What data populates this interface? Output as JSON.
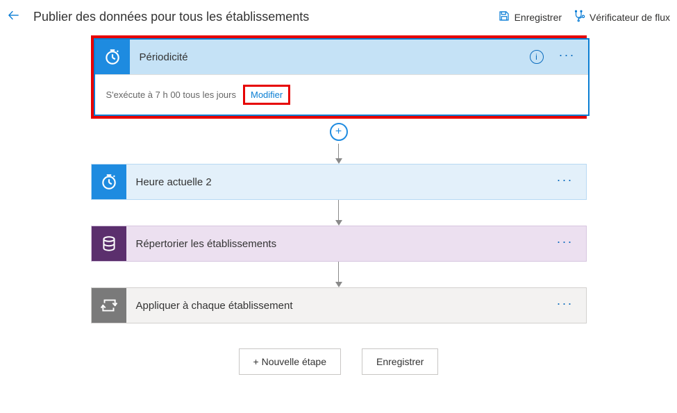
{
  "header": {
    "title": "Publier des données pour tous les établissements",
    "actions": {
      "save": "Enregistrer",
      "flow_checker": "Vérificateur de flux"
    }
  },
  "steps": {
    "periodicity": {
      "title": "Périodicité",
      "description": "S'exécute à 7 h 00 tous les jours",
      "modify": "Modifier"
    },
    "current_time": {
      "title": "Heure actuelle 2"
    },
    "list_establishments": {
      "title": "Répertorier les établissements"
    },
    "apply_each": {
      "title": "Appliquer à chaque établissement"
    }
  },
  "footer": {
    "new_step": "+ Nouvelle étape",
    "save": "Enregistrer"
  },
  "icons": {
    "back": "back-arrow-icon",
    "save": "save-icon",
    "stethoscope": "flow-checker-icon",
    "clock": "clock-icon",
    "database": "database-icon",
    "loop": "loop-icon",
    "info": "i"
  }
}
